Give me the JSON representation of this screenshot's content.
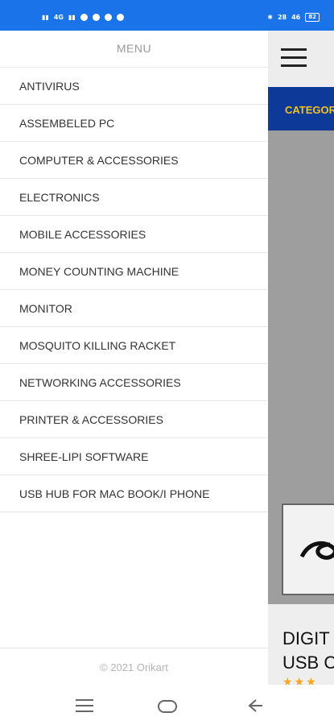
{
  "status_bar": {
    "left_text": "4G",
    "network_speed": "28",
    "network_unit": "K/s",
    "signal_right": "46",
    "battery": "82"
  },
  "background_page": {
    "category_label": "CATEGOR",
    "product_title_line1": "DIGIT",
    "product_title_line2": "USB C",
    "stars": "★★★"
  },
  "drawer": {
    "title": "MENU",
    "items": [
      "ANTIVIRUS",
      "ASSEMBELED PC",
      "COMPUTER & ACCESSORIES",
      "ELECTRONICS",
      "MOBILE ACCESSORIES",
      "MONEY COUNTING MACHINE",
      "MONITOR",
      "MOSQUITO KILLING RACKET",
      "NETWORKING ACCESSORIES",
      "PRINTER & ACCESSORIES",
      "SHREE-LIPI SOFTWARE",
      "USB HUB FOR MAC BOOK/I PHONE"
    ],
    "footer": "© 2021 Orikart"
  }
}
